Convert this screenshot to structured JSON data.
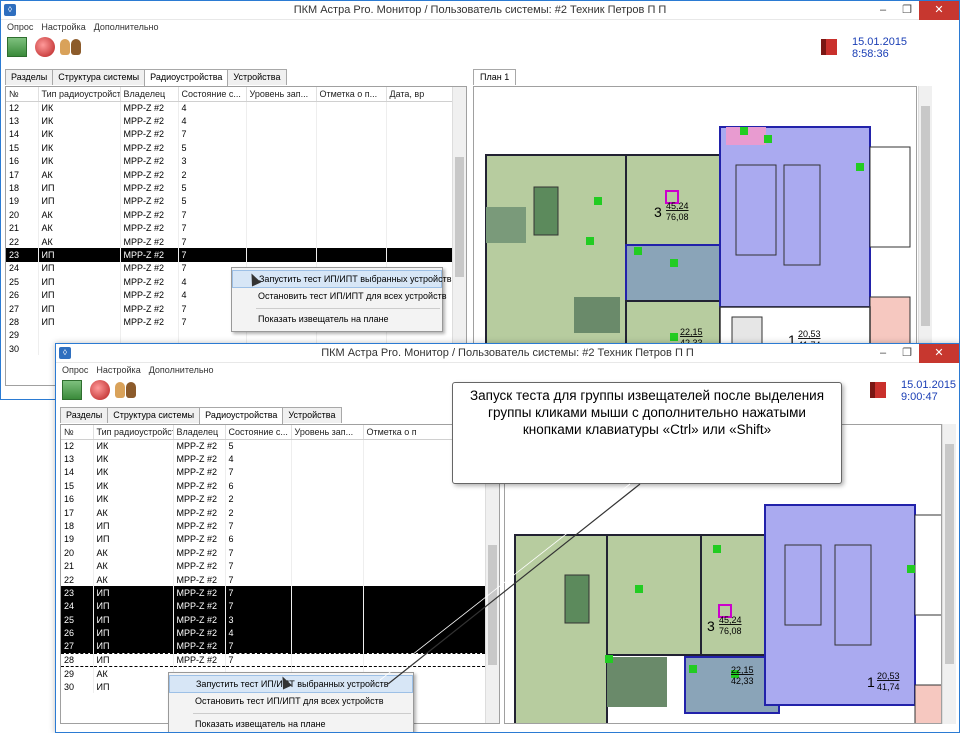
{
  "window1": {
    "title": "ПКМ Астра Pro. Монитор / Пользователь системы: #2 Техник Петров П П",
    "menu": [
      "Опрос",
      "Настройка",
      "Дополнительно"
    ],
    "date": "15.01.2015",
    "time": "8:58:36",
    "tabs": [
      "Разделы",
      "Структура системы",
      "Радиоустройства",
      "Устройства"
    ],
    "active_tab": "Радиоустройства",
    "columns": [
      "№",
      "Тип радиоустройства",
      "Владелец",
      "Состояние с...",
      "Уровень зап...",
      "Отметка о п...",
      "Дата, вр"
    ],
    "rows": [
      [
        "12",
        "ИК",
        "МРР-Z #2",
        "4"
      ],
      [
        "13",
        "ИК",
        "МРР-Z #2",
        "4"
      ],
      [
        "14",
        "ИК",
        "МРР-Z #2",
        "7"
      ],
      [
        "15",
        "ИК",
        "МРР-Z #2",
        "5"
      ],
      [
        "16",
        "ИК",
        "МРР-Z #2",
        "3"
      ],
      [
        "17",
        "АК",
        "МРР-Z #2",
        "2"
      ],
      [
        "18",
        "ИП",
        "МРР-Z #2",
        "5"
      ],
      [
        "19",
        "ИП",
        "МРР-Z #2",
        "5"
      ],
      [
        "20",
        "АК",
        "МРР-Z #2",
        "7"
      ],
      [
        "21",
        "АК",
        "МРР-Z #2",
        "7"
      ],
      [
        "22",
        "АК",
        "МРР-Z #2",
        "7"
      ],
      [
        "23",
        "ИП",
        "МРР-Z #2",
        "7"
      ],
      [
        "24",
        "ИП",
        "МРР-Z #2",
        "7"
      ],
      [
        "25",
        "ИП",
        "МРР-Z #2",
        "4"
      ],
      [
        "26",
        "ИП",
        "МРР-Z #2",
        "4"
      ],
      [
        "27",
        "ИП",
        "МРР-Z #2",
        "7"
      ],
      [
        "28",
        "ИП",
        "МРР-Z #2",
        "7"
      ],
      [
        "29",
        "",
        "",
        " "
      ],
      [
        "30",
        "",
        "",
        " "
      ]
    ],
    "plan_tab": "План 1",
    "context_menu": [
      "Запустить тест ИП/ИПТ выбранных устройств",
      "Остановить тест ИП/ИПТ для всех устройств",
      "Показать извещатель на плане"
    ]
  },
  "window2": {
    "title": "ПКМ Астра Pro. Монитор / Пользователь системы: #2 Техник Петров П П",
    "menu": [
      "Опрос",
      "Настройка",
      "Дополнительно"
    ],
    "date": "15.01.2015",
    "time": "9:00:47",
    "tabs": [
      "Разделы",
      "Структура системы",
      "Радиоустройства",
      "Устройства"
    ],
    "active_tab": "Радиоустройства",
    "columns": [
      "№",
      "Тип радиоустройства",
      "Владелец",
      "Состояние с...",
      "Уровень зап...",
      "Отметка о п"
    ],
    "rows": [
      [
        "12",
        "ИК",
        "МРР-Z #2",
        "5"
      ],
      [
        "13",
        "ИК",
        "МРР-Z #2",
        "4"
      ],
      [
        "14",
        "ИК",
        "МРР-Z #2",
        "7"
      ],
      [
        "15",
        "ИК",
        "МРР-Z #2",
        "6"
      ],
      [
        "16",
        "ИК",
        "МРР-Z #2",
        "2"
      ],
      [
        "17",
        "АК",
        "МРР-Z #2",
        "2"
      ],
      [
        "18",
        "ИП",
        "МРР-Z #2",
        "7"
      ],
      [
        "19",
        "ИП",
        "МРР-Z #2",
        "6"
      ],
      [
        "20",
        "АК",
        "МРР-Z #2",
        "7"
      ],
      [
        "21",
        "АК",
        "МРР-Z #2",
        "7"
      ],
      [
        "22",
        "АК",
        "МРР-Z #2",
        "7"
      ],
      [
        "23",
        "ИП",
        "МРР-Z #2",
        "7"
      ],
      [
        "24",
        "ИП",
        "МРР-Z #2",
        "7"
      ],
      [
        "25",
        "ИП",
        "МРР-Z #2",
        "3"
      ],
      [
        "26",
        "ИП",
        "МРР-Z #2",
        "4"
      ],
      [
        "27",
        "ИП",
        "МРР-Z #2",
        "7"
      ],
      [
        "28",
        "ИП",
        "МРР-Z #2",
        "7"
      ],
      [
        "29",
        "АК",
        "",
        ""
      ],
      [
        "30",
        "ИП",
        "",
        ""
      ]
    ],
    "context_menu": [
      "Запустить тест ИП/ИПТ выбранных устройств",
      "Остановить тест ИП/ИПТ для всех устройств",
      "Показать извещатель на плане"
    ]
  },
  "callout": "Запуск теста для группы извещателей после выделения группы кликами мыши с дополнительно нажатыми кнопками клавиатуры «Ctrl» или «Shift»",
  "plan_labels": {
    "room3_num": "3",
    "room3_a": "45,24",
    "room3_b": "76,08",
    "room2_a": "22,15",
    "room2_b": "42,33",
    "room1_num": "1",
    "room1_a": "20,53",
    "room1_b": "41,74"
  },
  "colors": {
    "selected_row": "#000000",
    "window_border": "#2b7bd3",
    "close_button": "#c7372f",
    "clock": "#1a3eb5",
    "plan_purple": "#aaaaf0",
    "plan_green": "#b7cc9f",
    "plan_blue": "#8aa4b8"
  }
}
